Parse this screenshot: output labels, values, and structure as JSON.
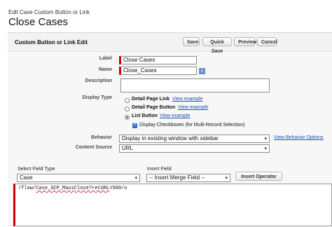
{
  "header": {
    "subtitle": "Edit Case Custom Button or Link",
    "title": "Close Cases"
  },
  "panel": {
    "title": "Custom Button or Link Edit"
  },
  "toolbar": {
    "save": "Save",
    "quick_save": "Quick Save",
    "preview": "Preview",
    "cancel": "Cancel"
  },
  "form": {
    "label_label": "Label",
    "label_value": "Close Cases",
    "name_label": "Name",
    "name_value": "Close_Cases",
    "description_label": "Description",
    "description_value": "",
    "display_type_label": "Display Type",
    "display_options": [
      {
        "label": "Detail Page Link",
        "link": "View example",
        "selected": false
      },
      {
        "label": "Detail Page Button",
        "link": "View example",
        "selected": false
      },
      {
        "label": "List Button",
        "link": "View example",
        "selected": true
      }
    ],
    "checkbox_label": "Display Checkboxes (for Multi-Record Selection)",
    "behavior_label": "Behavior",
    "behavior_value": "Display in existing window with sidebar",
    "behavior_link": "View Behavior Options",
    "content_source_label": "Content Source",
    "content_source_value": "URL"
  },
  "editor": {
    "field_type_label": "Select Field Type",
    "field_type_value": "Case",
    "insert_field_label": "Insert Field",
    "insert_field_value": "-- Insert Merge Field --",
    "insert_operator": "Insert Operator",
    "code_prefix": "/flow/",
    "code_squiggle": "Case_SCP_MassClose?retURL",
    "code_suffix": "=500/o"
  },
  "icons": {
    "info": "info-icon",
    "caret": "chevron-down-icon"
  },
  "colors": {
    "required": "#cc0000",
    "link": "#1f4fb3",
    "accent": "#2a6fc9"
  }
}
